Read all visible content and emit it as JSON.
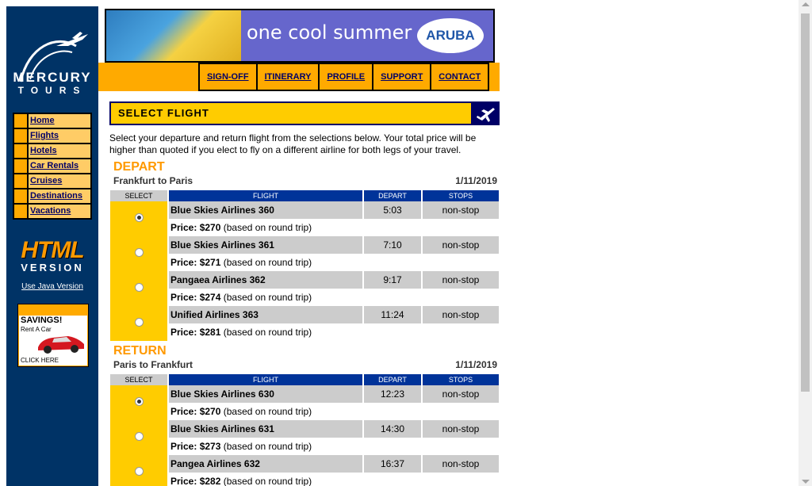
{
  "brand": {
    "line1": "MERCURY",
    "line2": "TOURS"
  },
  "sidebar": {
    "items": [
      {
        "label": "Home"
      },
      {
        "label": "Flights"
      },
      {
        "label": "Hotels"
      },
      {
        "label": "Car Rentals"
      },
      {
        "label": "Cruises"
      },
      {
        "label": "Destinations"
      },
      {
        "label": "Vacations"
      }
    ],
    "html_badge": {
      "big": "HTML",
      "small": "VERSION"
    },
    "java_link": "Use Java Version",
    "ad": {
      "title": "SAVINGS!",
      "sub": "Rent A Car",
      "click": "CLICK HERE"
    }
  },
  "banner": {
    "tagline": "one cool summer",
    "logo": "ARUBA"
  },
  "topnav": [
    {
      "label": "SIGN-OFF"
    },
    {
      "label": "ITINERARY"
    },
    {
      "label": "PROFILE"
    },
    {
      "label": "SUPPORT"
    },
    {
      "label": "CONTACT"
    }
  ],
  "section": {
    "title": "SELECT FLIGHT"
  },
  "intro": "Select your departure and return flight from the selections below. Your total price will be higher than quoted if you elect to fly on a different airline for both legs of your travel.",
  "columns": {
    "select": "SELECT",
    "flight": "FLIGHT",
    "depart": "DEPART",
    "stops": "STOPS"
  },
  "price_prefix": "Price:",
  "price_suffix": "(based on round trip)",
  "depart": {
    "heading": "DEPART",
    "route": "Frankfurt to Paris",
    "date": "1/11/2019",
    "flights": [
      {
        "name": "Blue Skies Airlines 360",
        "time": "5:03",
        "stops": "non-stop",
        "price": "$270",
        "selected": true
      },
      {
        "name": "Blue Skies Airlines 361",
        "time": "7:10",
        "stops": "non-stop",
        "price": "$271",
        "selected": false
      },
      {
        "name": "Pangaea Airlines 362",
        "time": "9:17",
        "stops": "non-stop",
        "price": "$274",
        "selected": false
      },
      {
        "name": "Unified Airlines 363",
        "time": "11:24",
        "stops": "non-stop",
        "price": "$281",
        "selected": false
      }
    ]
  },
  "return": {
    "heading": "RETURN",
    "route": "Paris to Frankfurt",
    "date": "1/11/2019",
    "flights": [
      {
        "name": "Blue Skies Airlines 630",
        "time": "12:23",
        "stops": "non-stop",
        "price": "$270",
        "selected": true
      },
      {
        "name": "Blue Skies Airlines 631",
        "time": "14:30",
        "stops": "non-stop",
        "price": "$273",
        "selected": false
      },
      {
        "name": "Pangea Airlines 632",
        "time": "16:37",
        "stops": "non-stop",
        "price": "$282",
        "selected": false
      }
    ]
  },
  "colors": {
    "navy": "#003366",
    "orange": "#ffaa00",
    "yellow": "#ffcc00",
    "header_blue": "#003399"
  }
}
